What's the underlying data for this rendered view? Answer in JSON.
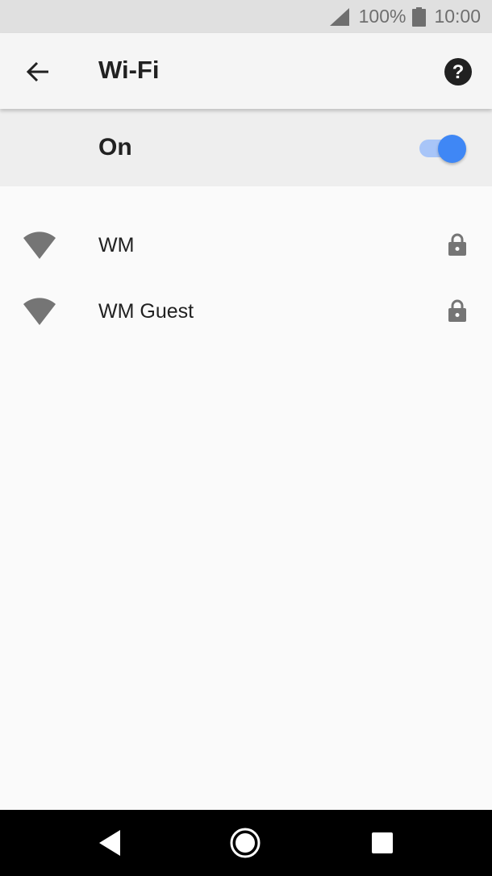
{
  "status_bar": {
    "battery_percent": "100%",
    "time": "10:00",
    "icons": [
      "signal-icon",
      "battery-icon"
    ]
  },
  "app_bar": {
    "title": "Wi-Fi",
    "back_icon": "arrow-back-icon",
    "help_icon": "help-icon"
  },
  "master_switch": {
    "label": "On",
    "state": true,
    "accent_color": "#3f87f5"
  },
  "networks": [
    {
      "name": "WM",
      "secured": true,
      "icon": "wifi-icon"
    },
    {
      "name": "WM Guest",
      "secured": true,
      "icon": "wifi-icon"
    }
  ],
  "nav_bar": {
    "icons": [
      "back-triangle-icon",
      "home-circle-icon",
      "recents-square-icon"
    ]
  }
}
